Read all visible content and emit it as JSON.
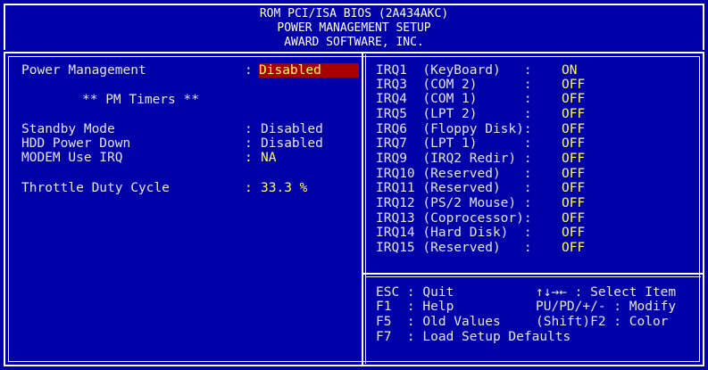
{
  "header": {
    "line1": "ROM PCI/ISA BIOS (2A434AKC)",
    "line2": "POWER MANAGEMENT SETUP",
    "line3": "AWARD SOFTWARE, INC."
  },
  "left": {
    "power_management": {
      "label": "Power Management",
      "sep": ":",
      "value": "Disabled"
    },
    "pm_timers_heading": "** PM Timers **",
    "standby_mode": {
      "label": "Standby Mode",
      "sep": ":",
      "value": "Disabled"
    },
    "hdd_power_down": {
      "label": "HDD Power Down",
      "sep": ":",
      "value": "Disabled"
    },
    "modem_use_irq": {
      "label": "MODEM Use IRQ",
      "sep": ":",
      "value": "NA"
    },
    "throttle_duty_cycle": {
      "label": "Throttle Duty Cycle",
      "sep": ":",
      "value": "33.3 %"
    }
  },
  "irqs": [
    {
      "label": "IRQ1  (KeyBoard)   :",
      "value": "ON"
    },
    {
      "label": "IRQ3  (COM 2)      :",
      "value": "OFF"
    },
    {
      "label": "IRQ4  (COM 1)      :",
      "value": "OFF"
    },
    {
      "label": "IRQ5  (LPT 2)      :",
      "value": "OFF"
    },
    {
      "label": "IRQ6  (Floppy Disk):",
      "value": "OFF"
    },
    {
      "label": "IRQ7  (LPT 1)      :",
      "value": "OFF"
    },
    {
      "label": "IRQ9  (IRQ2 Redir) :",
      "value": "OFF"
    },
    {
      "label": "IRQ10 (Reserved)   :",
      "value": "OFF"
    },
    {
      "label": "IRQ11 (Reserved)   :",
      "value": "OFF"
    },
    {
      "label": "IRQ12 (PS/2 Mouse) :",
      "value": "OFF"
    },
    {
      "label": "IRQ13 (Coprocessor):",
      "value": "OFF"
    },
    {
      "label": "IRQ14 (Hard Disk)  :",
      "value": "OFF"
    },
    {
      "label": "IRQ15 (Reserved)   :",
      "value": "OFF"
    }
  ],
  "help": {
    "esc": "ESC : Quit",
    "arrows": "↑↓→← : Select Item",
    "f1": "F1  : Help",
    "pupd": "PU/PD/+/- : Modify",
    "f5": "F5  : Old Values",
    "shiftf2": "(Shift)F2 : Color",
    "f7": "F7  : Load Setup Defaults"
  },
  "colors": {
    "background": "#0000a8",
    "text": "#e6e6e6",
    "value": "#ffff55",
    "highlight": "#a80000"
  }
}
